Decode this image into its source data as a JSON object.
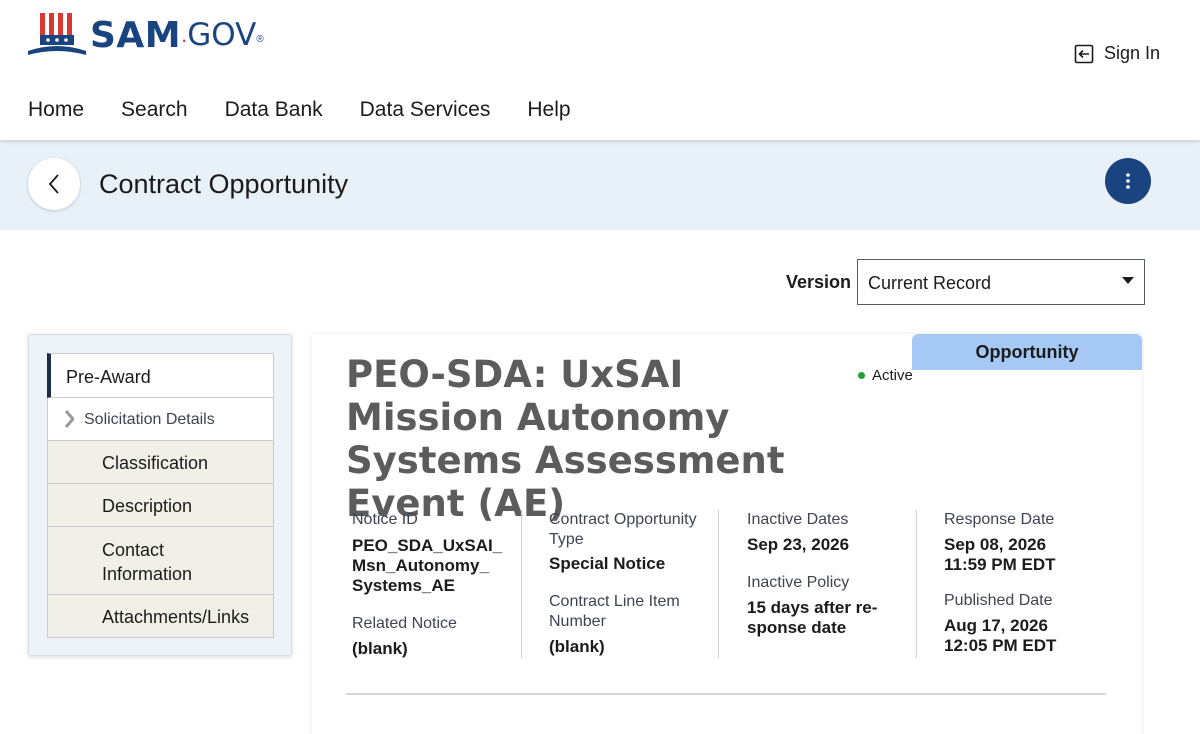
{
  "header": {
    "logo": {
      "brand": "SAM",
      "dot": ".",
      "tld": "GOV",
      "reg": "®"
    },
    "sign_in_label": "Sign In",
    "sign_in_icon": "sign-in-icon"
  },
  "nav": {
    "items": [
      "Home",
      "Search",
      "Data Bank",
      "Data Services",
      "Help"
    ]
  },
  "title_band": {
    "back_icon": "chevron-left-icon",
    "title": "Contract Opportunity",
    "actions_icon": "kebab-menu-icon"
  },
  "version": {
    "label": "Version",
    "selected": "Current Record"
  },
  "sidenav": {
    "items": [
      {
        "label": "Pre-Award"
      },
      {
        "label": "Solicitation Details"
      },
      {
        "label": "Classification"
      },
      {
        "label": "Description"
      },
      {
        "label": "Contact Information"
      },
      {
        "label": "Attachments/Links"
      }
    ]
  },
  "opportunity": {
    "tab_label": "Opportunity",
    "title": "PEO-SDA: UxSAI Mission Autonomy Systems Assessment Event (AE)",
    "status": "Active",
    "status_color": "#1fa12f",
    "notice_id_label": "Notice ID",
    "notice_id": "PEO_SDA_UxSAI_ Msn_Autonomy_ Systems_AE",
    "related_notice_label": "Related Notice",
    "related_notice": "(blank)",
    "contract_type_label": "Contract Opportunity Type",
    "contract_type": "Special Notice",
    "line_item_label": "Contract Line Item Number",
    "line_item": "(blank)",
    "inactive_dates_label": "Inactive Dates",
    "inactive_dates": "Sep 23, 2026",
    "inactive_policy_label": "Inactive Policy",
    "inactive_policy": "15 days after re- sponse date",
    "response_date_label": "Response Date",
    "response_date": "Sep 08, 2026 11:59 PM EDT",
    "published_date_label": "Published Date",
    "published_date": "Aug 17, 2026 12:05 PM EDT"
  },
  "colors": {
    "brand_navy": "#1a4480",
    "brand_red": "#d83933",
    "band_bg": "#e8f0f8",
    "tab_bg": "#a6c8f4"
  }
}
